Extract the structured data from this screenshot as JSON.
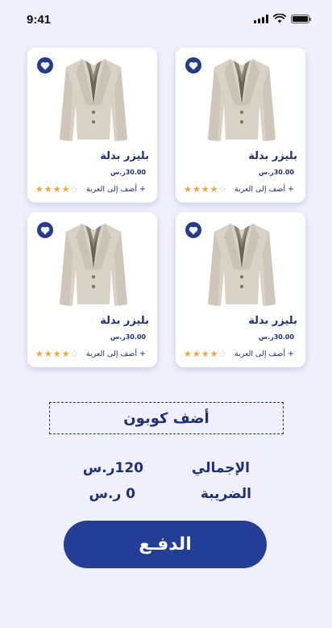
{
  "status_bar": {
    "time": "9:41"
  },
  "products": [
    {
      "name": "بليزر بدلة",
      "price": "30.00ر.س",
      "add_to_cart": "+ أضف إلى العربة",
      "rating": 4,
      "max_rating": 5
    },
    {
      "name": "بليزر بدلة",
      "price": "30.00ر.س",
      "add_to_cart": "+ أضف إلى العربة",
      "rating": 4,
      "max_rating": 5
    },
    {
      "name": "بليزر بدلة",
      "price": "30.00ر.س",
      "add_to_cart": "+ أضف إلى العربة",
      "rating": 4,
      "max_rating": 5
    },
    {
      "name": "بليزر بدلة",
      "price": "30.00ر.س",
      "add_to_cart": "+ أضف إلى العربة",
      "rating": 4,
      "max_rating": 5
    }
  ],
  "coupon": {
    "label": "أضف كوبون"
  },
  "summary": {
    "total_label": "الإجمالي",
    "total_value": "120ر.س",
    "tax_label": "الضريبة",
    "tax_value": "0 ر.س"
  },
  "pay_button": {
    "label": "الدفـع"
  },
  "icons": {
    "favorite": "heart-icon",
    "rating": "star-icon"
  },
  "colors": {
    "accent": "#223e96",
    "star": "#f4a42a",
    "background": "#eff0fc"
  }
}
